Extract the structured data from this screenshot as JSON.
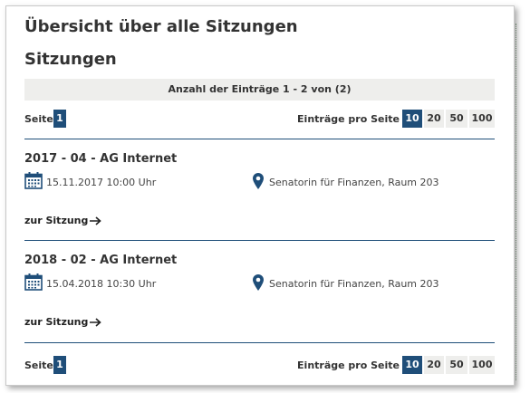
{
  "page": {
    "title": "Übersicht über alle Sitzungen",
    "subtitle": "Sitzungen"
  },
  "count_text": "Anzahl der Einträge 1 - 2 von (2)",
  "pager": {
    "page_label": "Seite",
    "current_page": "1",
    "per_page_label": "Einträge pro Seite",
    "per_page_options": [
      "10",
      "20",
      "50",
      "100"
    ],
    "per_page_selected": "10"
  },
  "sessions": [
    {
      "title": "2017 - 04 - AG Internet",
      "date": "15.11.2017 10:00 Uhr",
      "location": "Senatorin für Finanzen, Raum 203",
      "link": "zur Sitzung"
    },
    {
      "title": "2018 - 02 - AG Internet",
      "date": "15.04.2018 10:30 Uhr",
      "location": "Senatorin für Finanzen, Raum 203",
      "link": "zur Sitzung"
    }
  ],
  "colors": {
    "accent": "#1f4e79",
    "bar_bg": "#eeeeec"
  },
  "icons": {
    "calendar": "calendar-icon",
    "location": "location-pin-icon",
    "arrow": "arrow-right-icon"
  }
}
